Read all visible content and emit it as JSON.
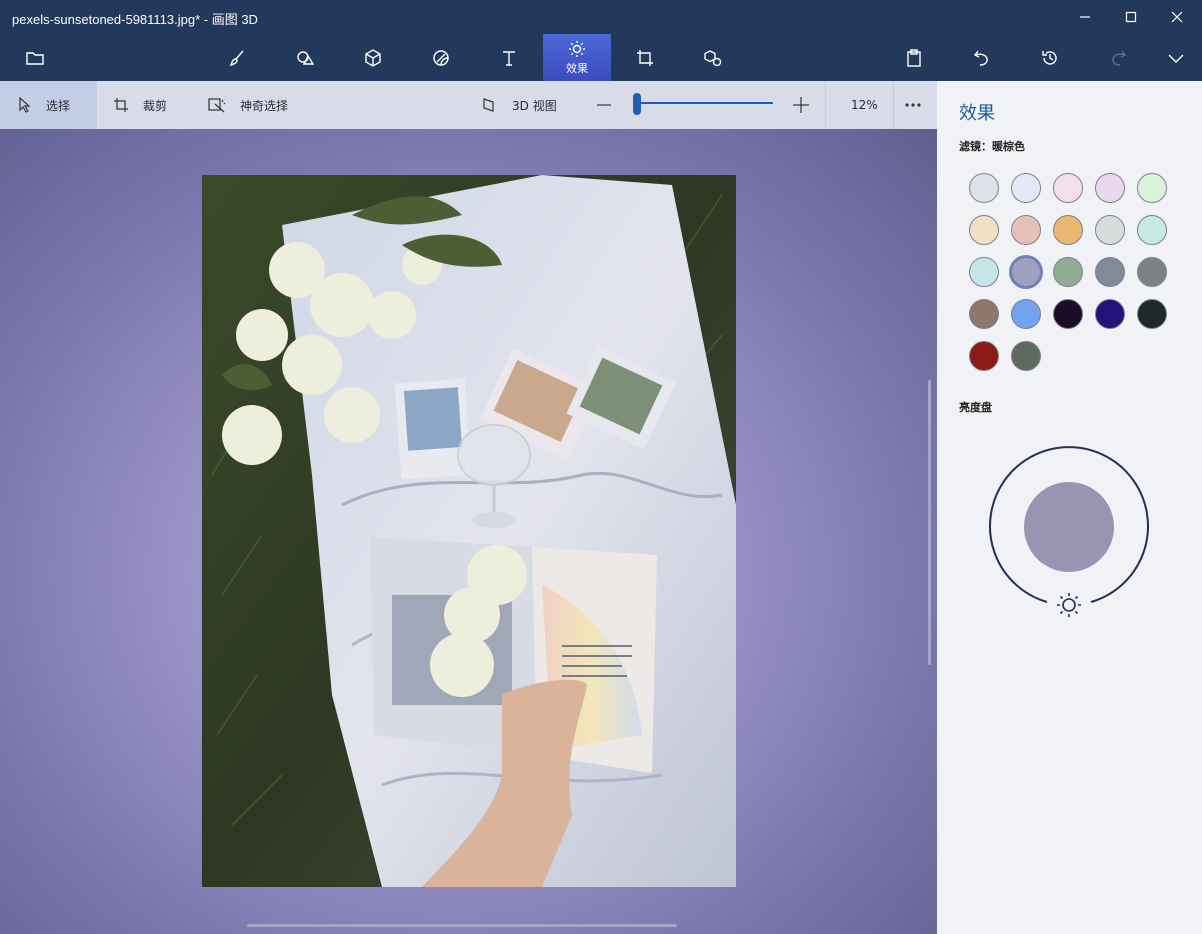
{
  "window": {
    "title": "pexels-sunsetoned-5981113.jpg* - 画图 3D"
  },
  "toolbar": {
    "items": [
      {
        "name": "menu",
        "icon": "folder-icon"
      },
      {
        "name": "brushes",
        "icon": "brush-icon"
      },
      {
        "name": "2d-shapes",
        "icon": "2d-shapes-icon"
      },
      {
        "name": "3d-shapes",
        "icon": "3d-cube-icon"
      },
      {
        "name": "stickers",
        "icon": "sticker-icon"
      },
      {
        "name": "text",
        "icon": "text-icon"
      },
      {
        "name": "effects",
        "icon": "effects-sun-icon",
        "label": "效果",
        "active": true
      },
      {
        "name": "canvas",
        "icon": "canvas-crop-icon"
      },
      {
        "name": "3d-library",
        "icon": "3d-library-icon"
      }
    ],
    "right": [
      "paste-icon",
      "undo-icon",
      "history-icon",
      "redo-icon",
      "expand-chevron-icon"
    ]
  },
  "subbar": {
    "select_label": "选择",
    "crop_label": "裁剪",
    "magic_select_label": "神奇选择",
    "view3d_label": "3D 视图",
    "zoom_value": "12%",
    "zoom_fraction": 0.03
  },
  "panel": {
    "title": "效果",
    "filter_label": "滤镜：暖棕色",
    "brightness_label": "亮度盘",
    "brightness_dial_color": "#9795b2",
    "filters": [
      "#dde2e8",
      "#e6e8f5",
      "#f2dfe9",
      "#ead9ee",
      "#dcf2d8",
      "#efe1c1",
      "#e5c0b9",
      "#e9b76f",
      "#d7dddc",
      "#c6e9e4",
      "#c6e6ea",
      "#9ea0c2",
      "#90ac95",
      "#7f8b98",
      "#7d8283",
      "#8e776a",
      "#74a3ee",
      "#1b0b24",
      "#23127a",
      "#1f2828",
      "#8e1a16",
      "#5f6a5e"
    ],
    "selected_filter": 11
  },
  "colors": {
    "title_bg": "#23395b",
    "accent": "#3e54c7",
    "panel_title": "#1d5b9a"
  }
}
